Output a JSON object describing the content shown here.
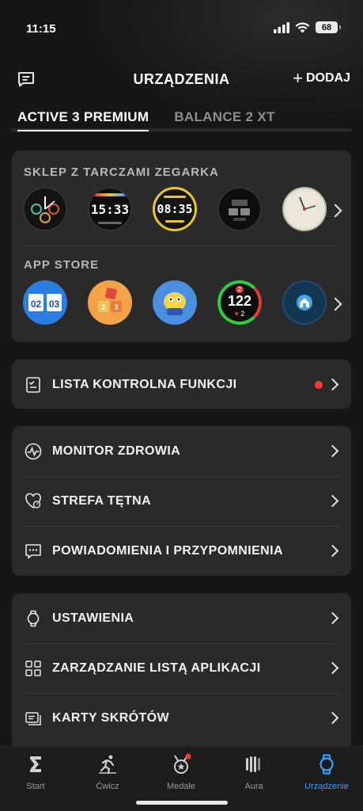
{
  "status": {
    "time": "11:15",
    "battery": "68"
  },
  "header": {
    "title": "URZĄDZENIA",
    "add_label": "DODAJ"
  },
  "tabs": [
    {
      "label": "ACTIVE 3 PREMIUM",
      "active": true
    },
    {
      "label": "BALANCE 2 XT",
      "active": false
    }
  ],
  "faces_store": {
    "title": "SKLEP Z TARCZAMI ZEGARKA",
    "faces": [
      {
        "name": "face-analog-dark"
      },
      {
        "name": "face-digital-1533",
        "time": "15:33"
      },
      {
        "name": "face-digital-0835",
        "time": "08:35"
      },
      {
        "name": "face-digital-grid"
      },
      {
        "name": "face-analog-cream"
      }
    ]
  },
  "app_store": {
    "title": "APP STORE",
    "apps": [
      {
        "name": "app-calendar",
        "text": "02 03"
      },
      {
        "name": "app-blocks",
        "text": "1 2 3"
      },
      {
        "name": "app-character"
      },
      {
        "name": "app-heart-counter",
        "value": "122",
        "sub": "2",
        "badge": "2"
      },
      {
        "name": "app-home"
      }
    ]
  },
  "checklist": {
    "label": "LISTA KONTROLNA FUNKCJI",
    "has_dot": true
  },
  "health_group": [
    {
      "label": "MONITOR ZDROWIA",
      "icon": "heartbeat-icon"
    },
    {
      "label": "STREFA TĘTNA",
      "icon": "heart-zone-icon"
    },
    {
      "label": "POWIADOMIENIA I PRZYPOMNIENIA",
      "icon": "chat-bubble-icon"
    }
  ],
  "settings_group": [
    {
      "label": "USTAWIENIA",
      "icon": "watch-icon"
    },
    {
      "label": "ZARZĄDZANIE LISTĄ APLIKACJI",
      "icon": "grid-icon"
    },
    {
      "label": "KARTY SKRÓTÓW",
      "icon": "cards-icon"
    }
  ],
  "tabbar": [
    {
      "label": "Start",
      "icon": "sigma-icon",
      "active": false
    },
    {
      "label": "Ćwicz",
      "icon": "runner-icon",
      "active": false
    },
    {
      "label": "Medale",
      "icon": "medal-icon",
      "active": false,
      "badge": true
    },
    {
      "label": "Aura",
      "icon": "aura-icon",
      "active": false
    },
    {
      "label": "Urządzenie",
      "icon": "watch-tab-icon",
      "active": true
    }
  ],
  "colors": {
    "accent": "#3aa0ff",
    "card": "#2a2a2a",
    "background": "#161616",
    "alert": "#ff3b30"
  }
}
